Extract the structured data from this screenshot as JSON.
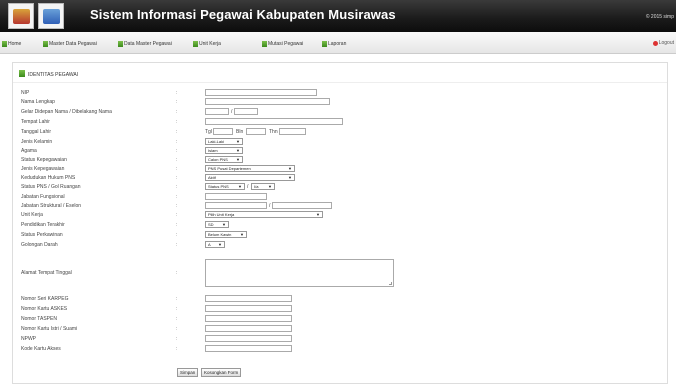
{
  "header": {
    "title": "Sistem Informasi Pegawai Kabupaten Musirawas",
    "copyright": "© 2015 simp"
  },
  "menu": {
    "home": "Home",
    "master_data_pegawai": "Master Data Pegawai",
    "data_master_pegawai": "Data Master Pegawai",
    "unit_kerja": "Unit Kerja",
    "mutasi_pegawai": "Mutasi Pegawai",
    "laporan": "Laporan",
    "logout": "Logout"
  },
  "panel": {
    "title": "IDENTITAS PEGAWAI"
  },
  "form": {
    "labels": {
      "nip": "NIP",
      "nama_lengkap": "Nama Lengkap",
      "gelar": "Gelar Didepan Nama / Dibelakang Nama",
      "tempat_lahir": "Tempat Lahir",
      "tanggal_lahir": "Tanggal Lahir",
      "jenis_kelamin": "Jenis Kelamin",
      "agama": "Agama",
      "status_kepegawaian": "Status Kepegawaian",
      "jenis_kepegawaian": "Jenis Kepegawaian",
      "kedudukan_hukum": "Kedudukan Hukum PNS",
      "status_pns_gol": "Status PNS / Gol Ruangan",
      "jabatan_fungsional": "Jabatan Fungsional",
      "jabatan_struktural": "Jabatan Struktural / Eselon",
      "unit_kerja": "Unit Kerja",
      "pendidikan": "Pendidikan Terakhir",
      "status_perkawinan": "Status Perkawinan",
      "golongan_darah": "Golongan Darah",
      "alamat": "Alamat Tempat Tinggal",
      "karpeg": "Nomor Seri KARPEG",
      "askes": "Nomor Kartu ASKES",
      "taspen": "Nomor TASPEN",
      "karis_karsu": "Nomor Kartu Istri / Suami",
      "npwp": "NPWP",
      "kode_akses": "Kode Kartu Akses"
    },
    "colon": ":",
    "slash": "/",
    "tgl_label": "Tgl",
    "bln_label": "Bln",
    "thn_label": "Thn",
    "values": {
      "jenis_kelamin": "Laki-Laki",
      "agama": "Islam",
      "status_kepegawaian": "Calon PNS",
      "jenis_kepegawaian": "PNS Pusat Departemen",
      "kedudukan_hukum": "Aktif",
      "status_pns": "Status PNS",
      "gol_ruangan": "I/a",
      "unit_kerja": "Pilih Unit Kerja",
      "pendidikan": "SD",
      "status_perkawinan": "Belum Kawin",
      "golongan_darah": "A"
    },
    "arrow": "▼",
    "buttons": {
      "simpan": "Simpan",
      "kosongkan": "Kosongkan Form"
    }
  }
}
